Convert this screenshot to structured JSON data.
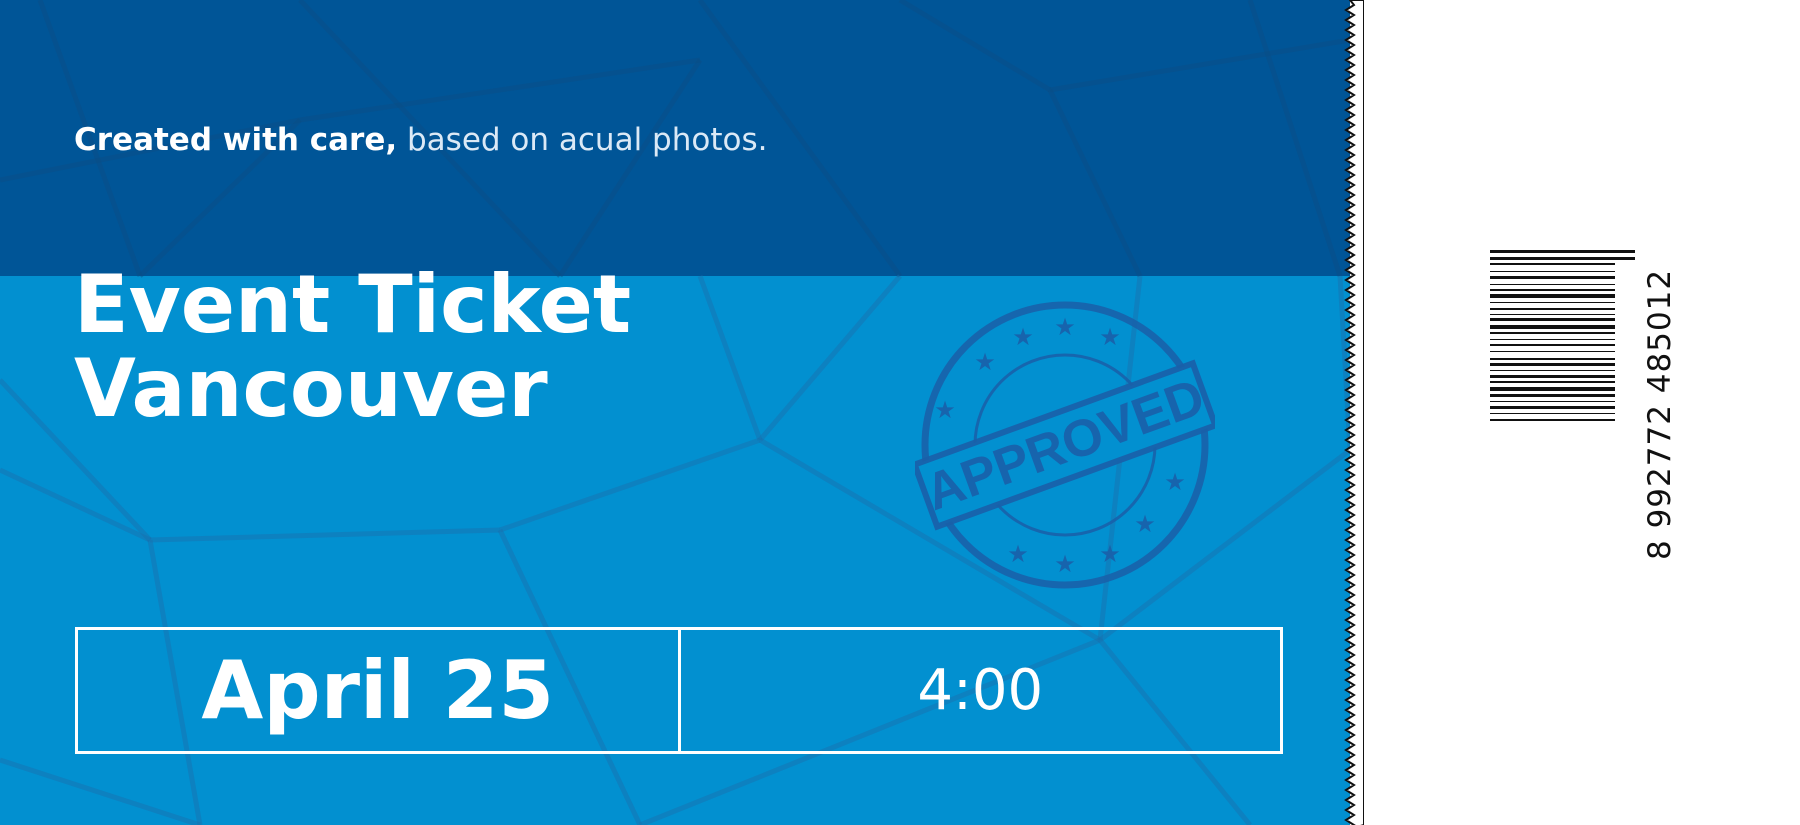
{
  "tagline": {
    "bold": "Created with care,",
    "light": " based on acual photos."
  },
  "title": {
    "line1": "Event Ticket",
    "line2": "Vancouver"
  },
  "stamp": {
    "text": "APPROVED",
    "color": "#1a5fa8"
  },
  "details": {
    "date": "April 25",
    "time": "4:00"
  },
  "barcode": {
    "number": "8 992772 485012"
  },
  "colors": {
    "header": "#005597",
    "body": "#0290d0",
    "stub": "#ffffff"
  }
}
